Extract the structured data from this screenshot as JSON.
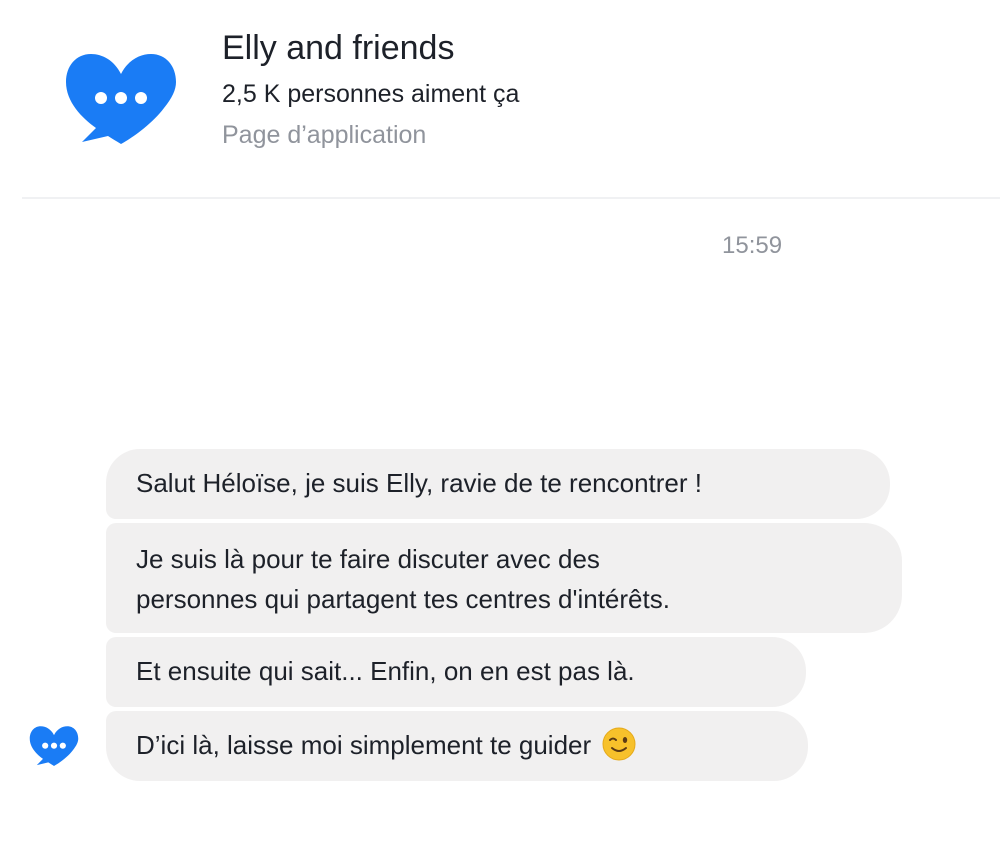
{
  "header": {
    "title": "Elly and friends",
    "likes": "2,5 K personnes aiment ça",
    "page_type": "Page d’application",
    "logo_icon": "heart-chat-icon"
  },
  "conversation": {
    "timestamp": "15:59",
    "sender_avatar_icon": "heart-chat-icon",
    "messages": [
      {
        "text": "Salut Héloïse, je suis Elly, ravie de te rencontrer !"
      },
      {
        "lines": [
          "Je suis là pour te faire discuter avec des",
          "personnes qui partagent tes centres d'intérêts."
        ]
      },
      {
        "text": "Et ensuite qui sait... Enfin, on en est pas là."
      },
      {
        "text": "D’ici là, laisse moi simplement te guider",
        "emoji_icon": "winking-face-emoji"
      }
    ]
  },
  "colors": {
    "brand_blue": "#1877f2",
    "bubble_gray": "#f1f0f0",
    "secondary_text": "#90949c"
  }
}
